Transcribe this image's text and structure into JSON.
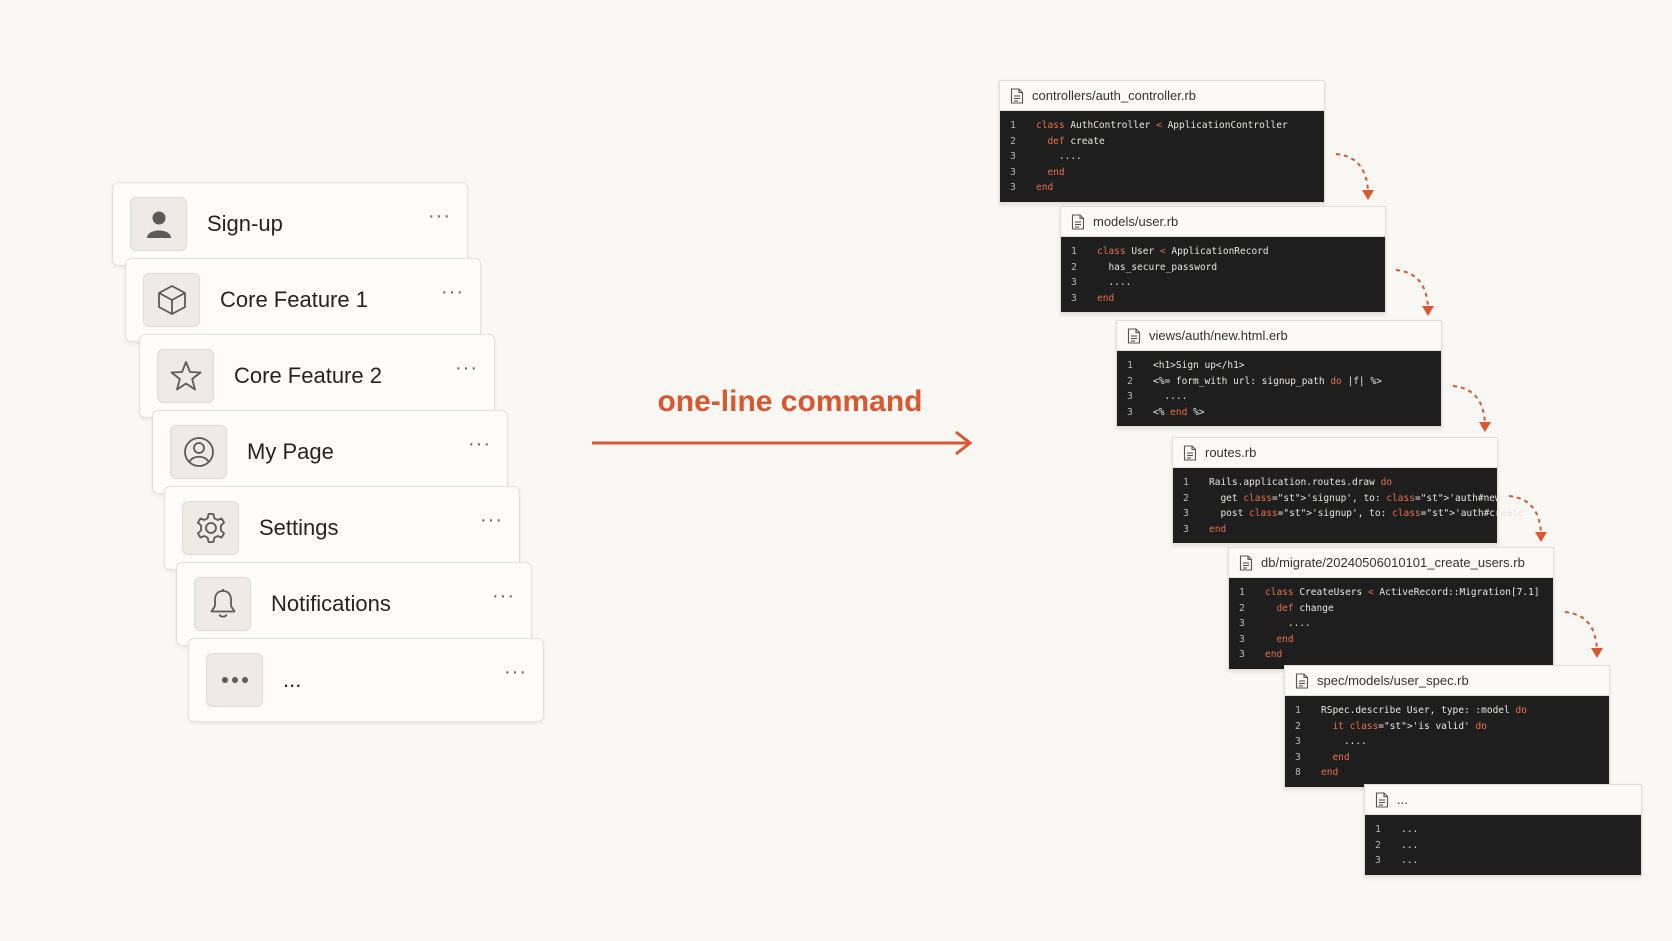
{
  "features": [
    {
      "label": "Sign-up",
      "icon": "person-icon"
    },
    {
      "label": "Core Feature 1",
      "icon": "cube-icon"
    },
    {
      "label": "Core Feature 2",
      "icon": "star-icon"
    },
    {
      "label": "My Page",
      "icon": "user-circle-icon"
    },
    {
      "label": "Settings",
      "icon": "gear-icon"
    },
    {
      "label": "Notifications",
      "icon": "bell-icon"
    },
    {
      "label": "...",
      "icon": "ellipsis-icon"
    }
  ],
  "more_label": "···",
  "command_label": "one-line command",
  "accent_color": "#d9582f",
  "files": [
    {
      "name": "controllers/auth_controller.rb",
      "lines": [
        {
          "n": "1",
          "t": "class AuthController < ApplicationController"
        },
        {
          "n": "2",
          "t": "  def create"
        },
        {
          "n": "3",
          "t": "    ...."
        },
        {
          "n": "3",
          "t": "  end"
        },
        {
          "n": "3",
          "t": "end"
        }
      ]
    },
    {
      "name": "models/user.rb",
      "lines": [
        {
          "n": "1",
          "t": "class User < ApplicationRecord"
        },
        {
          "n": "2",
          "t": "  has_secure_password"
        },
        {
          "n": "3",
          "t": "  ...."
        },
        {
          "n": "3",
          "t": "end"
        }
      ]
    },
    {
      "name": "views/auth/new.html.erb",
      "lines": [
        {
          "n": "1",
          "t": "<h1>Sign up</h1>"
        },
        {
          "n": "2",
          "t": "<%= form_with url: signup_path do |f| %>"
        },
        {
          "n": "3",
          "t": "  ...."
        },
        {
          "n": "3",
          "t": "<% end %>"
        }
      ]
    },
    {
      "name": "routes.rb",
      "lines": [
        {
          "n": "1",
          "t": "Rails.application.routes.draw do"
        },
        {
          "n": "2",
          "t": "  get 'signup', to: 'auth#new'"
        },
        {
          "n": "3",
          "t": "  post 'signup', to: 'auth#create'"
        },
        {
          "n": "3",
          "t": "end"
        }
      ]
    },
    {
      "name": "db/migrate/20240506010101_create_users.rb",
      "lines": [
        {
          "n": "1",
          "t": "class CreateUsers < ActiveRecord::Migration[7.1]"
        },
        {
          "n": "2",
          "t": "  def change"
        },
        {
          "n": "3",
          "t": "    ...."
        },
        {
          "n": "3",
          "t": "  end"
        },
        {
          "n": "3",
          "t": "end"
        }
      ]
    },
    {
      "name": "spec/models/user_spec.rb",
      "lines": [
        {
          "n": "1",
          "t": "RSpec.describe User, type: :model do"
        },
        {
          "n": "2",
          "t": "  it 'is valid' do"
        },
        {
          "n": "3",
          "t": "    ...."
        },
        {
          "n": "3",
          "t": "  end"
        },
        {
          "n": "8",
          "t": "end"
        }
      ]
    },
    {
      "name": "...",
      "lines": [
        {
          "n": "1",
          "t": "..."
        },
        {
          "n": "2",
          "t": "..."
        },
        {
          "n": "3",
          "t": "..."
        }
      ]
    }
  ]
}
